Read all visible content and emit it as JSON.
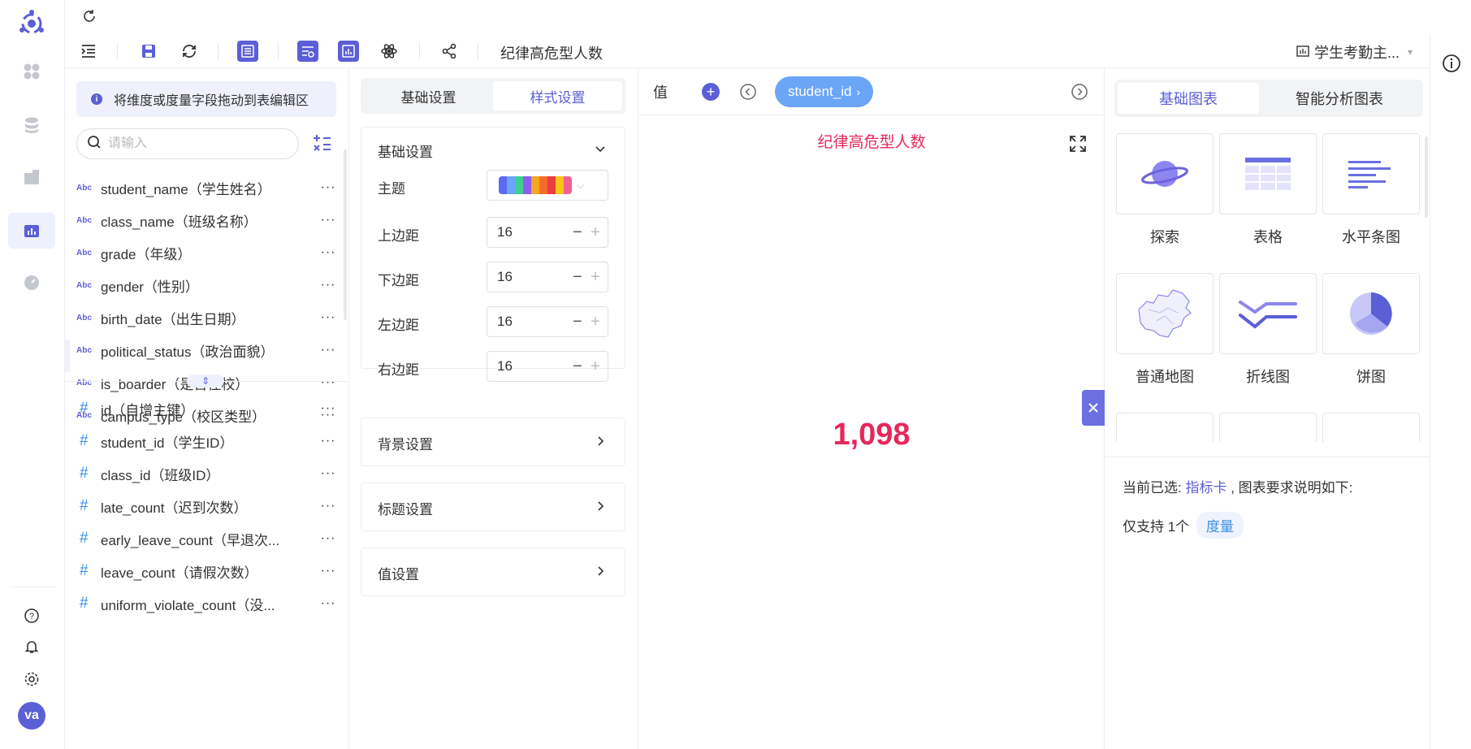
{
  "toolbar": {
    "page_title": "纪律高危型人数",
    "dataset": "学生考勤主..."
  },
  "fields_panel": {
    "hint": "将维度或度量字段拖动到表编辑区",
    "search_placeholder": "请输入",
    "dimensions": [
      {
        "type": "Abc",
        "name": "student_name（学生姓名）"
      },
      {
        "type": "Abc",
        "name": "class_name（班级名称）"
      },
      {
        "type": "Abc",
        "name": "grade（年级）"
      },
      {
        "type": "Abc",
        "name": "gender（性别）"
      },
      {
        "type": "Abc",
        "name": "birth_date（出生日期）"
      },
      {
        "type": "Abc",
        "name": "political_status（政治面貌）"
      },
      {
        "type": "Abc",
        "name": "is_boarder（是否住校）"
      },
      {
        "type": "Abc",
        "name": "campus_type（校区类型）"
      }
    ],
    "measures": [
      {
        "type": "#",
        "name": "id（自增主键）"
      },
      {
        "type": "#",
        "name": "student_id（学生ID）"
      },
      {
        "type": "#",
        "name": "class_id（班级ID）"
      },
      {
        "type": "#",
        "name": "late_count（迟到次数）"
      },
      {
        "type": "#",
        "name": "early_leave_count（早退次..."
      },
      {
        "type": "#",
        "name": "leave_count（请假次数）"
      },
      {
        "type": "#",
        "name": "uniform_violate_count（没..."
      }
    ],
    "more": "···"
  },
  "style_panel": {
    "tabs": [
      "基础设置",
      "样式设置"
    ],
    "basic": {
      "title": "基础设置",
      "theme_label": "主题",
      "theme_colors": [
        "#5b6bf5",
        "#6aa5f8",
        "#3ecf8e",
        "#8e5cf0",
        "#f5a623",
        "#f56c2a",
        "#e83e3e",
        "#f5c518",
        "#f06292"
      ],
      "rows": [
        {
          "label": "上边距",
          "value": "16"
        },
        {
          "label": "下边距",
          "value": "16"
        },
        {
          "label": "左边距",
          "value": "16"
        },
        {
          "label": "右边距",
          "value": "16"
        }
      ]
    },
    "sections": [
      "背景设置",
      "标题设置",
      "值设置"
    ]
  },
  "canvas": {
    "value_label": "值",
    "pill": "student_id",
    "chart_title": "纪律高危型人数",
    "value": "1,098"
  },
  "gallery": {
    "tabs": [
      "基础图表",
      "智能分析图表"
    ],
    "items": [
      "探索",
      "表格",
      "水平条图",
      "普通地图",
      "折线图",
      "饼图"
    ],
    "selected_prefix": "当前已选:",
    "selected_name": "指标卡",
    "selected_suffix": ", 图表要求说明如下:",
    "support_prefix": "仅支持 1个",
    "support_tag": "度量"
  },
  "nav": {
    "avatar": "va"
  },
  "colors": {
    "accent": "#5b5fd6",
    "value_red": "#e5285a",
    "pill_blue": "#6aa5f8"
  }
}
